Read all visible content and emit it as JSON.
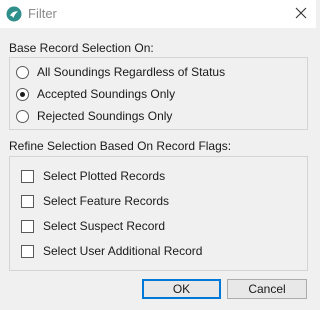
{
  "window": {
    "title": "Filter",
    "app_icon": "app-logo-icon",
    "close_icon": "close-icon"
  },
  "base_selection": {
    "label": "Base Record Selection On:",
    "options": [
      {
        "text": "All Soundings Regardless of Status",
        "selected": false
      },
      {
        "text": "Accepted Soundings Only",
        "selected": true
      },
      {
        "text": "Rejected Soundings Only",
        "selected": false
      }
    ]
  },
  "refine_selection": {
    "label": "Refine Selection Based On Record Flags:",
    "options": [
      {
        "text": "Select Plotted Records",
        "checked": false
      },
      {
        "text": "Select Feature Records",
        "checked": false
      },
      {
        "text": "Select Suspect Record",
        "checked": false
      },
      {
        "text": "Select User Additional Record",
        "checked": false
      }
    ]
  },
  "buttons": {
    "ok": "OK",
    "cancel": "Cancel"
  },
  "colors": {
    "accent": "#0078d7",
    "icon_teal": "#2f8f8a"
  }
}
